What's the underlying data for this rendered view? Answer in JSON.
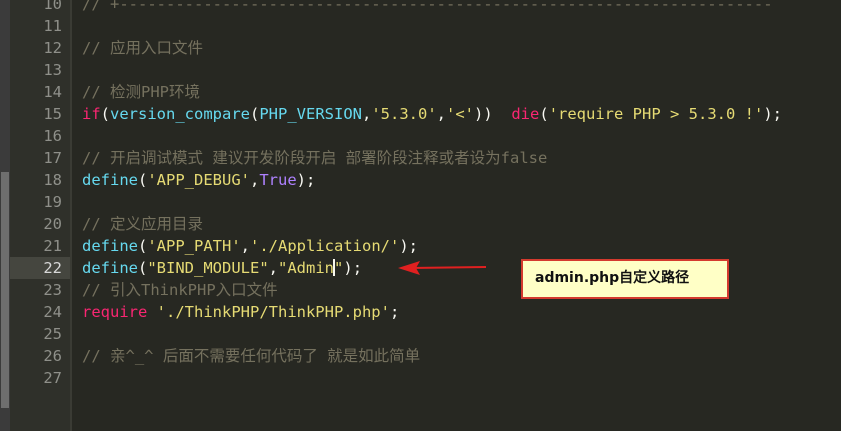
{
  "editor": {
    "lines": [
      {
        "num": "10",
        "text": "// +----------------------------------------------------------------------"
      },
      {
        "num": "11",
        "text": ""
      },
      {
        "num": "12",
        "text": "// 应用入口文件"
      },
      {
        "num": "13",
        "text": ""
      },
      {
        "num": "14",
        "text": "// 检测PHP环境"
      },
      {
        "num": "15",
        "text": "if(version_compare(PHP_VERSION,'5.3.0','<'))  die('require PHP > 5.3.0 !');"
      },
      {
        "num": "16",
        "text": ""
      },
      {
        "num": "17",
        "text": "// 开启调试模式 建议开发阶段开启 部署阶段注释或者设为false"
      },
      {
        "num": "18",
        "text": "define('APP_DEBUG',True);"
      },
      {
        "num": "19",
        "text": ""
      },
      {
        "num": "20",
        "text": "// 定义应用目录"
      },
      {
        "num": "21",
        "text": "define('APP_PATH','./Application/');"
      },
      {
        "num": "22",
        "text": "define(\"BIND_MODULE\",\"Admin\");"
      },
      {
        "num": "23",
        "text": "// 引入ThinkPHP入口文件"
      },
      {
        "num": "24",
        "text": "require './ThinkPHP/ThinkPHP.php';"
      },
      {
        "num": "25",
        "text": ""
      },
      {
        "num": "26",
        "text": "// 亲^_^ 后面不需要任何代码了 就是如此简单"
      },
      {
        "num": "27",
        "text": ""
      }
    ],
    "active_line": "22"
  },
  "callout": {
    "text": "admin.php自定义路径"
  },
  "colors": {
    "background": "#272822",
    "comment": "#75715e",
    "keyword": "#f92672",
    "function": "#66d9ef",
    "string": "#e6db74",
    "constant": "#ae81ff",
    "arrow": "#e02020"
  }
}
